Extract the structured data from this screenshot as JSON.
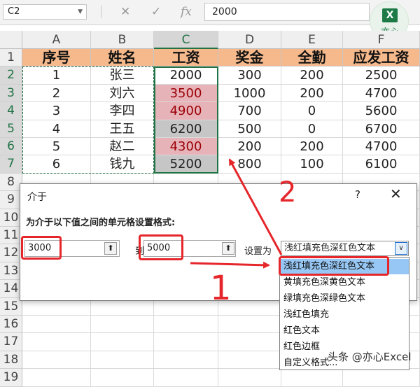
{
  "formula_bar": {
    "name_box": "C2",
    "cancel_icon": "✕",
    "enter_icon": "✓",
    "fx_label": "fx",
    "formula_value": "2000"
  },
  "logo": {
    "mark": "X",
    "text": "亦心"
  },
  "grid": {
    "columns": [
      "A",
      "B",
      "C",
      "D",
      "E",
      "F"
    ],
    "rows": [
      "1",
      "2",
      "3",
      "4",
      "5",
      "6",
      "7",
      "8",
      "9",
      "10",
      "11",
      "12",
      "13",
      "14",
      "15",
      "16",
      "17",
      "18",
      "19"
    ],
    "headers": [
      "序号",
      "姓名",
      "工资",
      "奖金",
      "全勤",
      "应发工资"
    ],
    "records": [
      [
        "1",
        "张三",
        "2000",
        "300",
        "200",
        "2500"
      ],
      [
        "2",
        "刘六",
        "3500",
        "1000",
        "200",
        "4700"
      ],
      [
        "3",
        "李四",
        "4900",
        "700",
        "0",
        "5600"
      ],
      [
        "4",
        "王五",
        "6200",
        "500",
        "0",
        "6700"
      ],
      [
        "5",
        "赵二",
        "4300",
        "200",
        "200",
        "4700"
      ],
      [
        "6",
        "钱九",
        "5200",
        "800",
        "100",
        "6100"
      ]
    ],
    "salary_highlight": [
      "none",
      "pink",
      "pink",
      "grey",
      "pink",
      "grey"
    ]
  },
  "dialog": {
    "title": "介于",
    "help": "?",
    "close": "✕",
    "prompt": "为介于以下值之间的单元格设置格式:",
    "min_value": "3000",
    "max_value": "5000",
    "to_label": "到",
    "set_as_label": "设置为",
    "selected_format": "浅红填充色深红色文本",
    "collapse_icon": "⬆",
    "dropdown_arrow": "∨"
  },
  "format_options": [
    "浅红填充色深红色文本",
    "黄填充色深黄色文本",
    "绿填充色深绿色文本",
    "浅红色填充",
    "红色文本",
    "红色边框",
    "自定义格式..."
  ],
  "annotations": {
    "step1": "1",
    "step2": "2"
  },
  "watermark": "头条 @亦心Excel",
  "colors": {
    "header_fill": "#f5b98c",
    "light_red_fill": "#e6b3b8",
    "dark_red_text": "#9c0006",
    "grey_fill": "#c6c6c6",
    "excel_green": "#217346",
    "annotation_red": "#e5262b",
    "list_highlight": "#97c7f5"
  }
}
